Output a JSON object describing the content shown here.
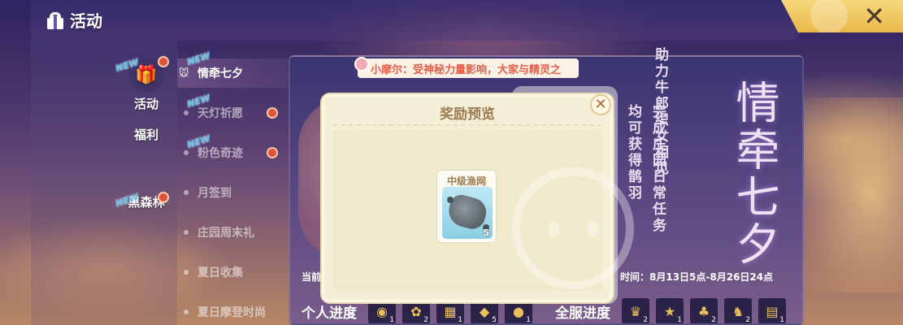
{
  "header": {
    "title": "活动"
  },
  "categories": [
    {
      "label": "活动",
      "icon": "gift-icon",
      "new_tag": "NEW",
      "badge": true
    },
    {
      "label": "福利",
      "icon": "bag-icon",
      "new_tag": "",
      "badge": false
    },
    {
      "label": "黑森林",
      "icon": "forest-icon",
      "new_tag": "NEW",
      "badge": true
    }
  ],
  "sub_menu": [
    {
      "label": "情牵七夕",
      "active": true,
      "new_tag": "NEW",
      "badge": false
    },
    {
      "label": "天灯祈愿",
      "active": false,
      "new_tag": "NEW",
      "badge": true
    },
    {
      "label": "粉色奇迹",
      "active": false,
      "new_tag": "NEW",
      "badge": true
    },
    {
      "label": "月签到",
      "active": false,
      "new_tag": "",
      "badge": false
    },
    {
      "label": "庄园周末礼",
      "active": false,
      "new_tag": "",
      "badge": false
    },
    {
      "label": "夏日收集",
      "active": false,
      "new_tag": "",
      "badge": false
    },
    {
      "label": "夏日摩登时尚",
      "active": false,
      "new_tag": "",
      "badge": false
    }
  ],
  "ticker": {
    "text": "小摩尔：受神秘力量影响，大家与精灵之"
  },
  "event": {
    "title": "情牵七夕",
    "poem_col1": "助力牛郎织女相见",
    "poem_col2": "均可获得鹊羽",
    "poem_col3": "完成庄园日常任务",
    "current_label": "当前",
    "time": "时间：8月13日5点-8月26日24点",
    "personal_progress": "个人进度",
    "server_progress": "全服进度",
    "personal_slots": [
      1,
      2,
      1,
      5,
      1
    ],
    "server_slots": [
      2,
      1,
      2,
      2,
      1
    ]
  },
  "modal": {
    "title": "奖励预览",
    "close_icon": "close-icon",
    "item": {
      "name": "中级渔网",
      "count": "5",
      "icon": "fishing-net-icon"
    }
  },
  "colors": {
    "accent": "#e9b949",
    "modal_bg": "#f6efd8",
    "title_brown": "#9b7b52",
    "badge_red": "#e0533b"
  }
}
